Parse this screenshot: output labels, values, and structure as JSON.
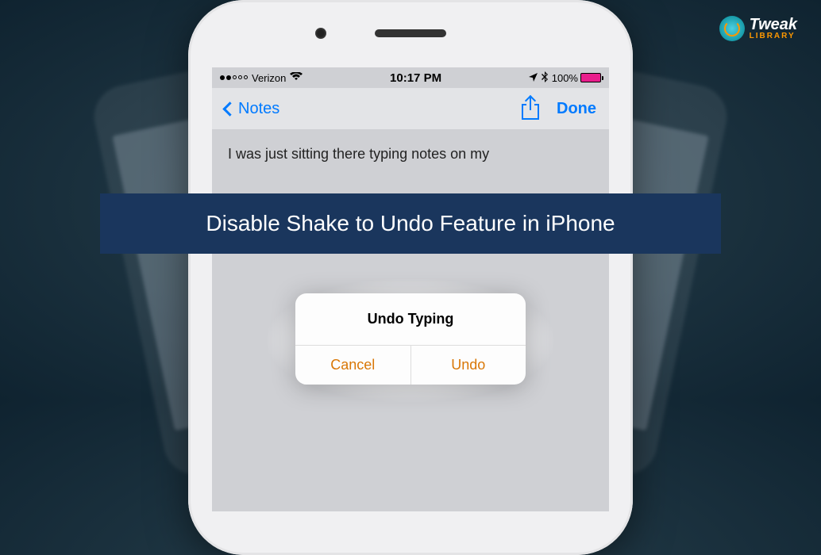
{
  "brand": {
    "name": "Tweak",
    "sub": "LIBRARY"
  },
  "banner": {
    "title": "Disable Shake to Undo Feature in iPhone"
  },
  "status_bar": {
    "carrier": "Verizon",
    "time": "10:17 PM",
    "battery_pct": "100%"
  },
  "nav": {
    "back_label": "Notes",
    "done_label": "Done"
  },
  "note": {
    "text": "I was just sitting there typing notes on my"
  },
  "dialog": {
    "title": "Undo Typing",
    "cancel": "Cancel",
    "undo": "Undo"
  }
}
